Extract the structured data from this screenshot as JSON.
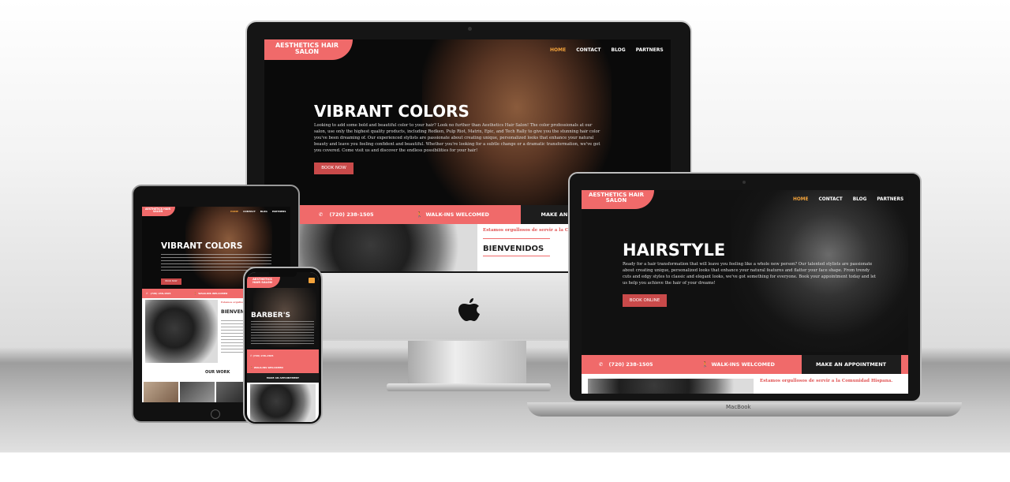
{
  "desktop": {
    "logo": "AESTHETICS HAIR SALON",
    "nav": [
      "HOME",
      "CONTACT",
      "BLOG",
      "PARTNERS"
    ],
    "hero_title": "VIBRANT COLORS",
    "hero_text": "Looking to add some bold and beautiful color to your hair? Look no further than Aesthetics Hair Salon! The color professionals at our salon, use only the highest quality products, including Redken, Pulp Riot, Matrix, Epic, and Tech Rally to give you the stunning hair color you've been dreaming of. Our experienced stylists are passionate about creating unique, personalized looks that enhance your natural beauty and leave you feeling confident and beautiful. Whether you're looking for a subtle change or a dramatic transformation, we've got you covered. Come visit us and discover the endless possibilities for your hair!",
    "hero_button": "BOOK NOW",
    "phone": "(720) 238-1505",
    "walkins": "WALK-INS WELCOMED",
    "appointment": "MAKE AN A",
    "welcome_es": "Estamos orgullosos de servir a la Comu",
    "welcome_heading": "BIENVENIDOS"
  },
  "laptop": {
    "logo": "AESTHETICS HAIR SALON",
    "nav": [
      "HOME",
      "CONTACT",
      "BLOG",
      "PARTNERS"
    ],
    "hero_title": "HAIRSTYLE",
    "hero_text": "Ready for a hair transformation that will leave you feeling like a whole new person? Our talented stylists are passionate about creating unique, personalized looks that enhance your natural features and flatter your face shape. From trendy cuts and edgy styles to classic and elegant looks, we've got something for everyone. Book your appointment today and let us help you achieve the hair of your dreams!",
    "hero_button": "BOOK ONLINE",
    "phone": "(720) 238-1505",
    "walkins": "WALK-INS WELCOMED",
    "appointment": "MAKE AN APPOINTMENT",
    "welcome_es": "Estamos orgullosos de servir a la Comunidad Hispana.",
    "brand": "MacBook"
  },
  "tablet": {
    "logo": "AESTHETICS HAIR SALON",
    "nav": [
      "HOME",
      "CONTACT",
      "BLOG",
      "PARTNERS"
    ],
    "hero_title": "VIBRANT COLORS",
    "hero_button": "BOOK NOW",
    "phone": "(720) 238-1505",
    "walkins": "WALK-INS WELCOMED",
    "welcome_es": "Estamos orgullosos",
    "welcome_heading": "BIENVENID",
    "section": "OUR WORK"
  },
  "phone": {
    "logo": "AESTHETICS HAIR SALON",
    "hero_title": "BARBER'S",
    "phone": "(720) 238-1505",
    "walkins": "WALK-INS WELCOMED",
    "appointment": "MAKE AN APPOINTMENT"
  },
  "colors": {
    "accent": "#f06a6a",
    "active_nav": "#f3a33b",
    "button": "#c94a4a",
    "dark": "#1d1d1d"
  },
  "icons": [
    "phone-icon",
    "walking-person-icon",
    "apple-logo-icon",
    "hamburger-menu-icon"
  ]
}
